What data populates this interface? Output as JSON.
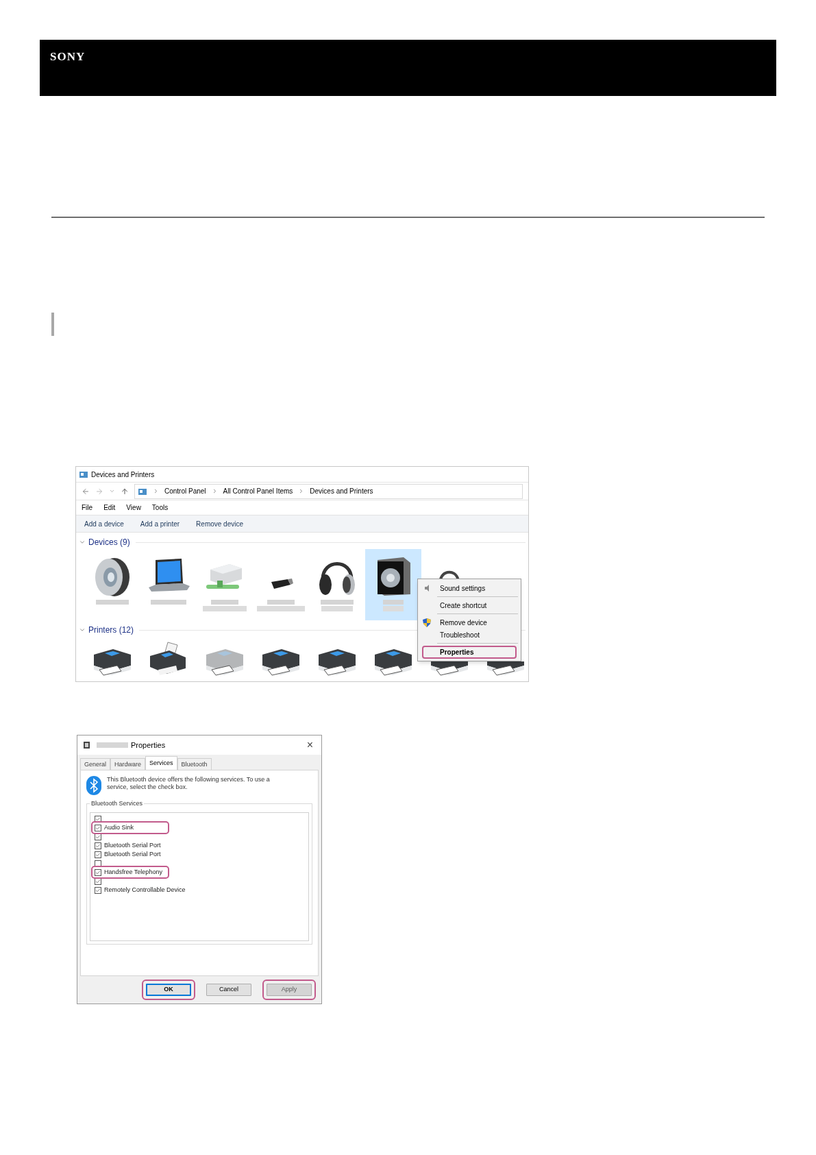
{
  "header": {
    "logo": "SONY"
  },
  "devices_window": {
    "title": "Devices and Printers",
    "breadcrumb": [
      "Control Panel",
      "All Control Panel Items",
      "Devices and Printers"
    ],
    "menu": [
      "File",
      "Edit",
      "View",
      "Tools"
    ],
    "commands": [
      "Add a device",
      "Add a printer",
      "Remove device"
    ],
    "groups": [
      {
        "label": "Devices (9)",
        "expanded": true,
        "items": [
          {
            "kind": "speaker",
            "selected": false
          },
          {
            "kind": "laptop",
            "selected": false
          },
          {
            "kind": "drive",
            "selected": false
          },
          {
            "kind": "dongle",
            "selected": false
          },
          {
            "kind": "headphones",
            "selected": false
          },
          {
            "kind": "speaker-box",
            "selected": true
          },
          {
            "kind": "headset",
            "selected": false
          }
        ]
      },
      {
        "label": "Printers (12)",
        "expanded": true,
        "items": [
          {
            "kind": "printer"
          },
          {
            "kind": "fax"
          },
          {
            "kind": "printer-offline"
          },
          {
            "kind": "printer"
          },
          {
            "kind": "printer"
          },
          {
            "kind": "printer"
          },
          {
            "kind": "printer"
          },
          {
            "kind": "printer"
          }
        ]
      }
    ],
    "context_menu": [
      {
        "kind": "sound",
        "label": "Sound settings",
        "bold": false,
        "highlighted": false
      },
      {
        "kind": "separator"
      },
      {
        "kind": "plain",
        "label": "Create shortcut",
        "bold": false,
        "highlighted": false
      },
      {
        "kind": "separator"
      },
      {
        "kind": "shield",
        "label": "Remove device",
        "bold": false,
        "highlighted": false
      },
      {
        "kind": "plain",
        "label": "Troubleshoot",
        "bold": false,
        "highlighted": false
      },
      {
        "kind": "separator"
      },
      {
        "kind": "plain",
        "label": "Properties",
        "bold": true,
        "highlighted": true
      }
    ]
  },
  "properties_dialog": {
    "title": "Properties",
    "close": "×",
    "tabs": [
      {
        "label": "General",
        "selected": false
      },
      {
        "label": "Hardware",
        "selected": false
      },
      {
        "label": "Services",
        "selected": true
      },
      {
        "label": "Bluetooth",
        "selected": false
      }
    ],
    "description": "This Bluetooth device offers the following services. To use a service, select the check box.",
    "group_label": "Bluetooth Services",
    "services": [
      {
        "checked": true,
        "highlighted": false
      },
      {
        "label": "Audio Sink",
        "checked": true,
        "highlighted": true
      },
      {
        "checked": true,
        "highlighted": false
      },
      {
        "label": "Bluetooth Serial Port",
        "checked": true,
        "highlighted": false
      },
      {
        "label": "Bluetooth Serial Port",
        "checked": true,
        "highlighted": false
      },
      {
        "checked": false,
        "highlighted": false
      },
      {
        "label": "Handsfree Telephony",
        "checked": true,
        "highlighted": true
      },
      {
        "checked": true,
        "highlighted": false
      },
      {
        "label": "Remotely Controllable Device",
        "checked": true,
        "highlighted": false
      }
    ],
    "buttons": [
      {
        "label": "OK",
        "default": true,
        "disabled": false,
        "highlighted": true
      },
      {
        "label": "Cancel",
        "default": false,
        "disabled": false,
        "highlighted": false
      },
      {
        "label": "Apply",
        "default": false,
        "disabled": true,
        "highlighted": true
      }
    ]
  }
}
